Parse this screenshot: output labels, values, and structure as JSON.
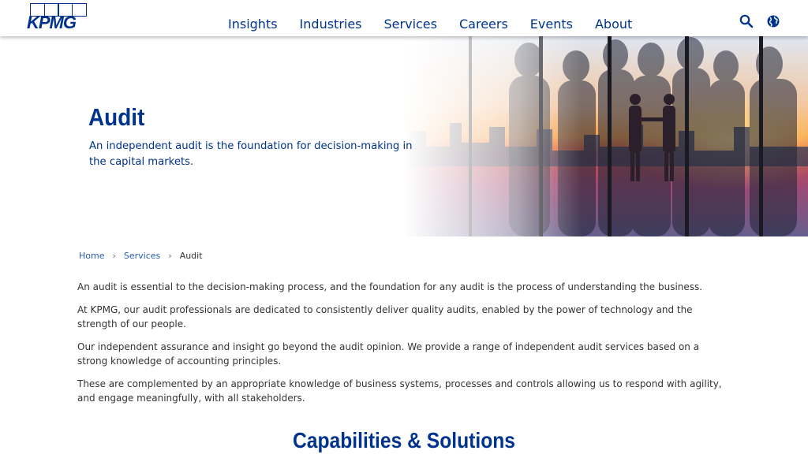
{
  "brand": {
    "logo_text": "KPMG",
    "primary_color": "#00338d"
  },
  "nav": {
    "items": [
      {
        "label": "Insights"
      },
      {
        "label": "Industries"
      },
      {
        "label": "Services"
      },
      {
        "label": "Careers"
      },
      {
        "label": "Events"
      },
      {
        "label": "About"
      }
    ],
    "search_icon": "search-icon",
    "globe_icon": "globe-icon"
  },
  "hero": {
    "title": "Audit",
    "subtitle": "An independent audit is the foundation for decision-making in the capital markets.",
    "image": "business-people-silhouettes-city-skyline"
  },
  "breadcrumb": {
    "home": "Home",
    "services": "Services",
    "current": "Audit",
    "separator": "›"
  },
  "content": {
    "paragraphs": [
      "An audit is essential to the decision-making process, and the foundation for any audit is the process of understanding the business.",
      "At KPMG, our audit professionals are dedicated to consistently deliver quality audits, enabled by the power of technology and the strength of our people.",
      "Our independent assurance and insight go beyond the audit opinion. We provide a range of independent audit services based on a strong knowledge of accounting principles.",
      "These are complemented by an appropriate knowledge of business systems, processes and controls allowing us to respond with agility, and engage meaningfully, with all stakeholders."
    ]
  },
  "section": {
    "title": "Capabilities & Solutions"
  }
}
